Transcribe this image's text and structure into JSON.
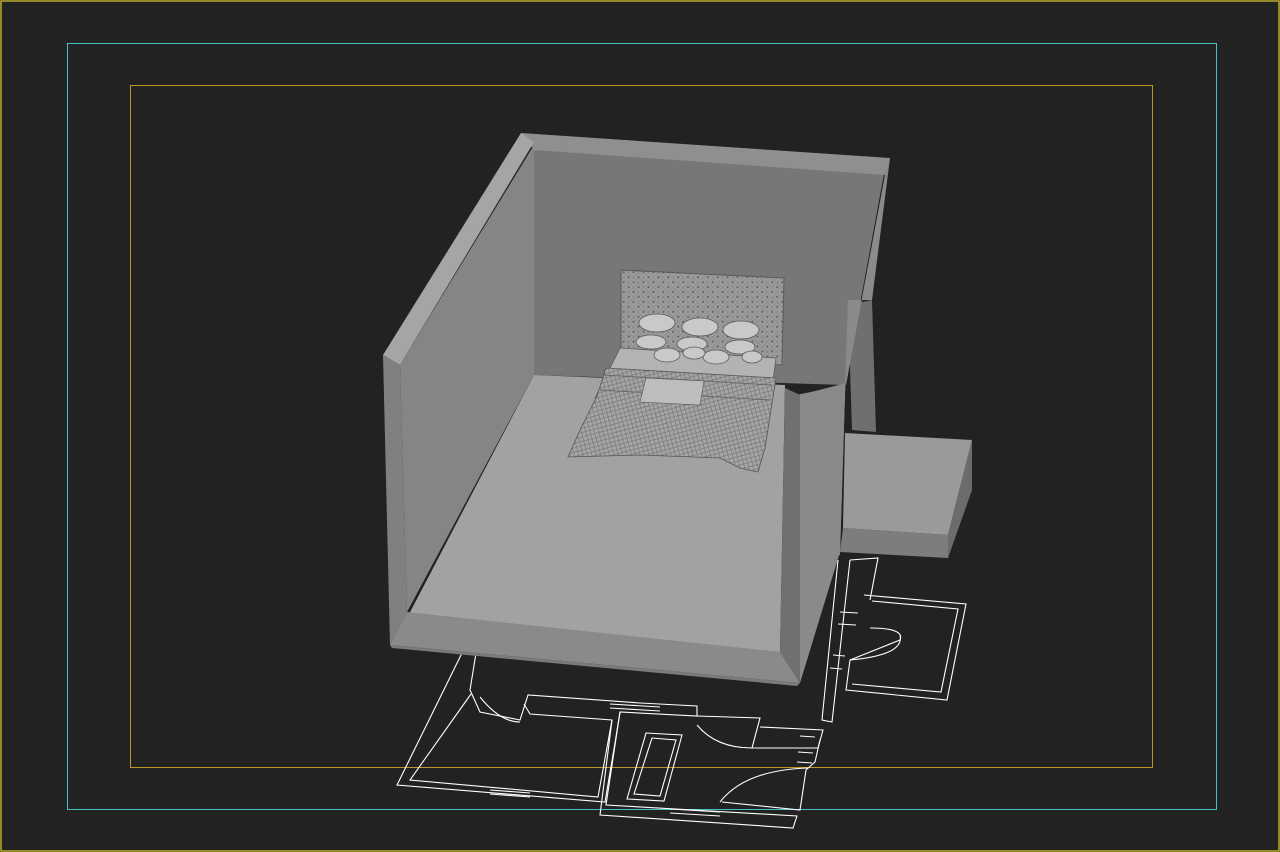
{
  "viewport": {
    "kind": "3d-perspective-viewport",
    "background": "#222222"
  },
  "frames": {
    "active_border_color": "#c8b428",
    "render_frame_color": "#46bec8",
    "safe_frame_color": "#be9628"
  },
  "scene": {
    "room_color": "#8c8c8c",
    "floor_color": "#a0a0a0",
    "floorplan_line_color": "#ffffff",
    "objects": [
      "room-shell",
      "double-bed",
      "side-ledge",
      "cad-floor-plan"
    ]
  }
}
